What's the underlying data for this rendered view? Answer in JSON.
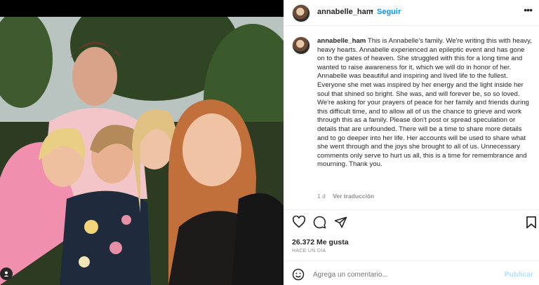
{
  "post": {
    "username": "annabelle_ham",
    "separator": "•",
    "follow_label": "Seguir",
    "more_label": "•••",
    "caption_user": "annabelle_ham",
    "caption_text": "This is Annabelle's family. We're writing this with heavy, heavy hearts. Annabelle experienced an epileptic event and has gone on to the gates of heaven. She struggled with this for a long time and wanted to raise awareness for it, which we will do in honor of her. Annabelle was beautiful and inspiring and lived life to the fullest. Everyone she met was inspired by her energy and the light inside her soul that shined so bright. She was, and will forever be, so so loved. We're asking for your prayers of peace for her family and friends during this difficult time, and to allow all of us the chance to grieve and work through this as a family. Please don't post or spread speculation or details that are unfounded. There will be a time to share more details and to go deeper into her life. Her accounts will be used to share what she went through and the joys she brought to all of us. Unnecessary comments only serve to hurt us all, this is a time for remembrance and mourning. Thank you.",
    "caption_age": "1 d",
    "translation_label": "Ver traducción",
    "likes": "26.372 Me gusta",
    "posted_time": "HACE UN DÍA",
    "comment_placeholder": "Agrega un comentario...",
    "publish_label": "Publicar"
  },
  "icons": {
    "like": "heart-icon",
    "comment": "comment-icon",
    "share": "send-icon",
    "save": "bookmark-icon",
    "emoji": "emoji-icon",
    "user_tag": "user-tag-icon"
  },
  "colors": {
    "link_blue": "#0095f6",
    "publish_disabled": "#b2dffc",
    "secondary_text": "#8e8e8e"
  }
}
